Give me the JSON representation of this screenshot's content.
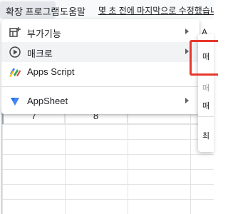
{
  "menubar": {
    "extensions_label": "확장 프로그램",
    "help_label": "도움말",
    "last_edit_text": "몇 초 전에 마지막으로 수정했습니다"
  },
  "dropdown": {
    "items": [
      {
        "label": "부가기능",
        "icon": "addon-icon",
        "has_submenu": true
      },
      {
        "label": "매크로",
        "icon": "play-circle-icon",
        "has_submenu": true
      },
      {
        "label": "Apps Script",
        "icon": "apps-script-icon",
        "has_submenu": false
      },
      {
        "label": "AppSheet",
        "icon": "appsheet-icon",
        "has_submenu": true
      }
    ]
  },
  "submenu": {
    "items": [
      {
        "label": "매"
      },
      {
        "label": "매"
      },
      {
        "label": "매"
      },
      {
        "label": "최"
      }
    ]
  },
  "grid": {
    "column_header_partial": "A",
    "row_cells": [
      "7",
      "8"
    ]
  },
  "colors": {
    "highlight_box": "#e6382c",
    "menubar_bg": "#f8f9fa",
    "active_menu_bg": "#e3e6ea"
  }
}
